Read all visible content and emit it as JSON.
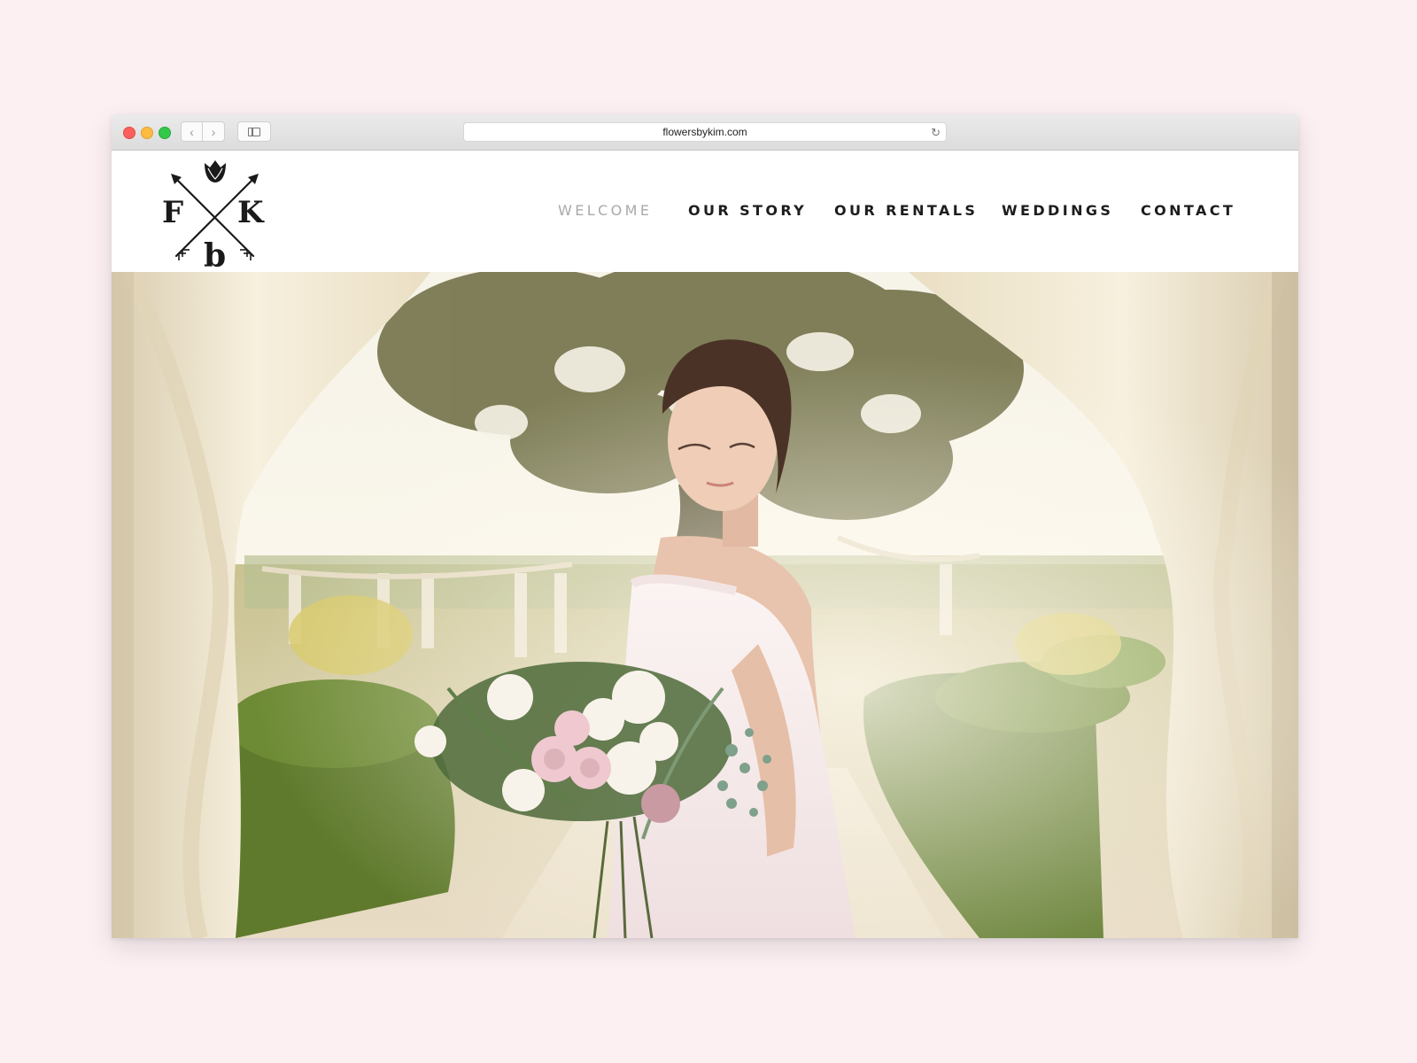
{
  "browser": {
    "url": "flowersbykim.com",
    "back_glyph": "‹",
    "forward_glyph": "›",
    "reload_glyph": "↻",
    "traffic_lights": [
      "#fc605c",
      "#fdbc40",
      "#34c84a"
    ]
  },
  "logo": {
    "letter_left": "F",
    "letter_right": "K",
    "letter_bottom": "b",
    "icon": "tulip-crossed-arrows-icon"
  },
  "nav": {
    "items": [
      {
        "label": "WELCOME",
        "active": true
      },
      {
        "label": "OUR STORY",
        "active": false
      },
      {
        "label": "OUR RENTALS",
        "active": false
      },
      {
        "label": "WEDDINGS",
        "active": false
      },
      {
        "label": "CONTACT",
        "active": false
      }
    ]
  },
  "hero": {
    "image": "bride-with-bouquet-under-draped-arch-photo"
  },
  "colors": {
    "page_background": "#fcf0f3",
    "nav_text": "#1d1d1d",
    "nav_active": "#a9a9a9"
  }
}
